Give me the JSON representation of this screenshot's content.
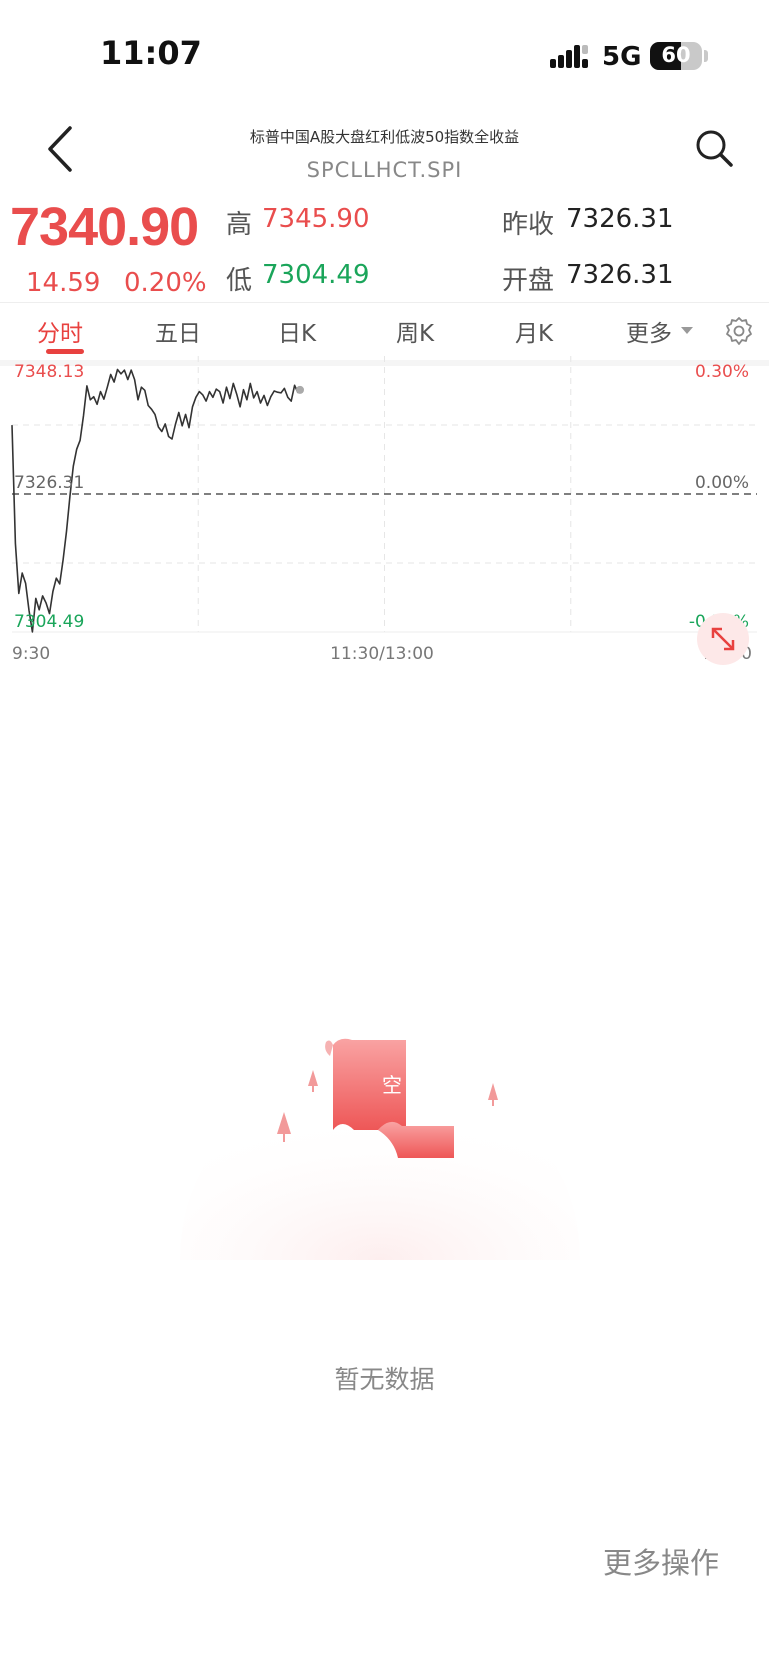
{
  "status_bar": {
    "time": "11:07",
    "network": "5G",
    "battery": "60"
  },
  "header": {
    "title": "标普中国A股大盘红利低波50指数全收益",
    "code": "SPCLLHCT.SPI"
  },
  "quote": {
    "price": "7340.90",
    "change": "14.59",
    "change_pct": "0.20%",
    "high_label": "高",
    "high": "7345.90",
    "low_label": "低",
    "low": "7304.49",
    "prev_close_label": "昨收",
    "prev_close": "7326.31",
    "open_label": "开盘",
    "open": "7326.31"
  },
  "tabs": [
    {
      "label": "分时",
      "active": true
    },
    {
      "label": "五日"
    },
    {
      "label": "日K"
    },
    {
      "label": "周K"
    },
    {
      "label": "月K"
    },
    {
      "label": "更多"
    }
  ],
  "chart_data": {
    "type": "line",
    "title": "",
    "y_max_label": "7348.13",
    "y_mid_label": "7326.31",
    "y_min_label": "7304.49",
    "pct_max_label": "0.30%",
    "pct_mid_label": "0.00%",
    "pct_min_label": "-0.30%",
    "ylim": [
      7304.49,
      7348.13
    ],
    "reference_value": 7326.31,
    "x_ticks": [
      "9:30",
      "11:30/13:00",
      "15:00"
    ],
    "session_minutes": 240,
    "series": [
      {
        "values": [
          7337.2,
          7318.5,
          7310.6,
          7313.8,
          7312.2,
          7307.9,
          7304.5,
          7309.8,
          7308.0,
          7310.2,
          7309.1,
          7307.4,
          7310.9,
          7313.0,
          7312.1,
          7315.9,
          7320.4,
          7325.9,
          7330.7,
          7333.4,
          7334.8,
          7338.7,
          7343.4,
          7341.2,
          7341.7,
          7340.5,
          7342.5,
          7341.3,
          7343.2,
          7345.2,
          7344.0,
          7346.0,
          7345.3,
          7345.9,
          7344.4,
          7345.9,
          7344.4,
          7341.2,
          7343.2,
          7342.7,
          7340.3,
          7339.7,
          7338.9,
          7336.9,
          7336.2,
          7337.4,
          7335.4,
          7335.0,
          7337.3,
          7339.2,
          7337.1,
          7338.9,
          7336.8,
          7340.1,
          7341.6,
          7342.5,
          7342.0,
          7341.0,
          7342.5,
          7341.6,
          7342.9,
          7342.5,
          7340.7,
          7343.2,
          7341.4,
          7343.8,
          7342.1,
          7340.1,
          7342.8,
          7341.2,
          7343.8,
          7341.5,
          7342.5,
          7340.7,
          7341.9,
          7340.3,
          7341.7,
          7342.6,
          7342.4,
          7342.3,
          7343.0,
          7341.6,
          7341.0,
          7343.5,
          7342.3
        ]
      }
    ]
  },
  "empty_state": {
    "badge": "空",
    "text": "暂无数据"
  },
  "footer": {
    "more_ops": "更多操作"
  },
  "colors": {
    "up": "#e94d4d",
    "down": "#1aa55a",
    "accent": "#e8413f"
  }
}
